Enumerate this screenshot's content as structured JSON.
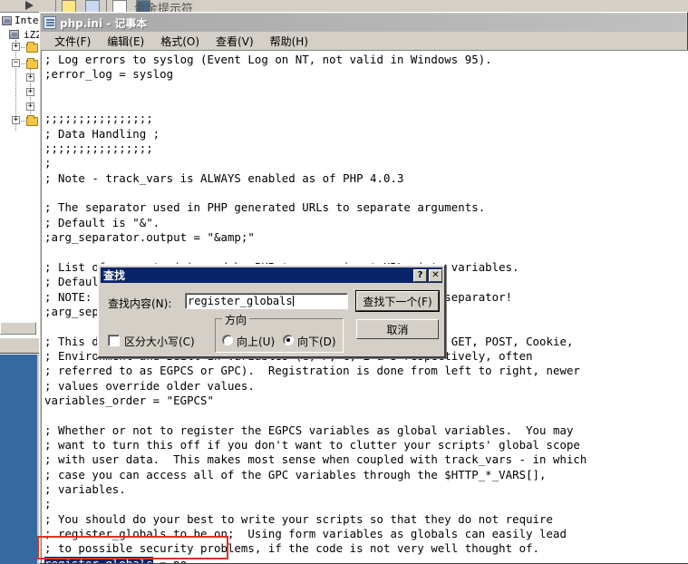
{
  "taskbar": {
    "window_title_cjk": "金金提示符"
  },
  "explorer": {
    "root_label": "Interr",
    "machine_label": "iZ2",
    "tree_expanders": [
      "+",
      "−",
      "+",
      "+",
      "+",
      "+"
    ]
  },
  "notepad": {
    "title": "php.ini - 记事本",
    "title_icon": "notepad-icon",
    "menu": [
      {
        "label": "文件(F)",
        "name": "menu-file"
      },
      {
        "label": "编辑(E)",
        "name": "menu-edit"
      },
      {
        "label": "格式(O)",
        "name": "menu-format"
      },
      {
        "label": "查看(V)",
        "name": "menu-view"
      },
      {
        "label": "帮助(H)",
        "name": "menu-help"
      }
    ],
    "text_lines": [
      "; Log errors to syslog (Event Log on NT, not valid in Windows 95).",
      ";error_log = syslog",
      "",
      "",
      ";;;;;;;;;;;;;;;;",
      "; Data Handling ;",
      ";;;;;;;;;;;;;;;;",
      ";",
      "; Note - track_vars is ALWAYS enabled as of PHP 4.0.3",
      "",
      "; The separator used in PHP generated URLs to separate arguments.",
      "; Default is \"&\".",
      ";arg_separator.output = \"&amp;\"",
      "",
      "; List of separator(s) used by PHP to parse input URLs into variables.",
      "; Default is \"&\".",
      "; NOTE: Every character in this directive is considered as separator!",
      ";arg_separator.input = \";&\"",
      "",
      "; This directive describes the order in which PHP registers GET, POST, Cookie,",
      "; Environment and Built-in variables (G, P, C, E & S respectively, often",
      "; referred to as EGPCS or GPC).  Registration is done from left to right, newer",
      "; values override older values.",
      "variables_order = \"EGPCS\"",
      "",
      "; Whether or not to register the EGPCS variables as global variables.  You may",
      "; want to turn this off if you don't want to clutter your scripts' global scope",
      "; with user data.  This makes most sense when coupled with track_vars - in which",
      "; case you can access all of the GPC variables through the $HTTP_*_VARS[],",
      "; variables.",
      ";",
      "; You should do your best to write your scripts so that they do not require",
      "; register_globals to be on;  Using form variables as globals can easily lead",
      "; to possible security problems, if the code is not very well thought of."
    ],
    "highlighted_token": "register_globals",
    "final_line_rest": " = no"
  },
  "find_dialog": {
    "title": "查找",
    "help_button": "?",
    "close_button": "✕",
    "find_what_label": "查找内容(N):",
    "find_what_value": "register_globals",
    "match_case_label": "区分大小写(C)",
    "match_case_checked": false,
    "direction_group_label": "方向",
    "direction_up_label": "向上(U)",
    "direction_down_label": "向下(D)",
    "direction_selected": "down",
    "find_next_label": "查找下一个(F)",
    "cancel_label": "取消"
  },
  "colors": {
    "title_selected": "#0a246a",
    "dialog_face": "#d4d0c8",
    "selection": "#0a246a",
    "annotation_red": "#e03020",
    "desktop_blue": "#36699f"
  }
}
